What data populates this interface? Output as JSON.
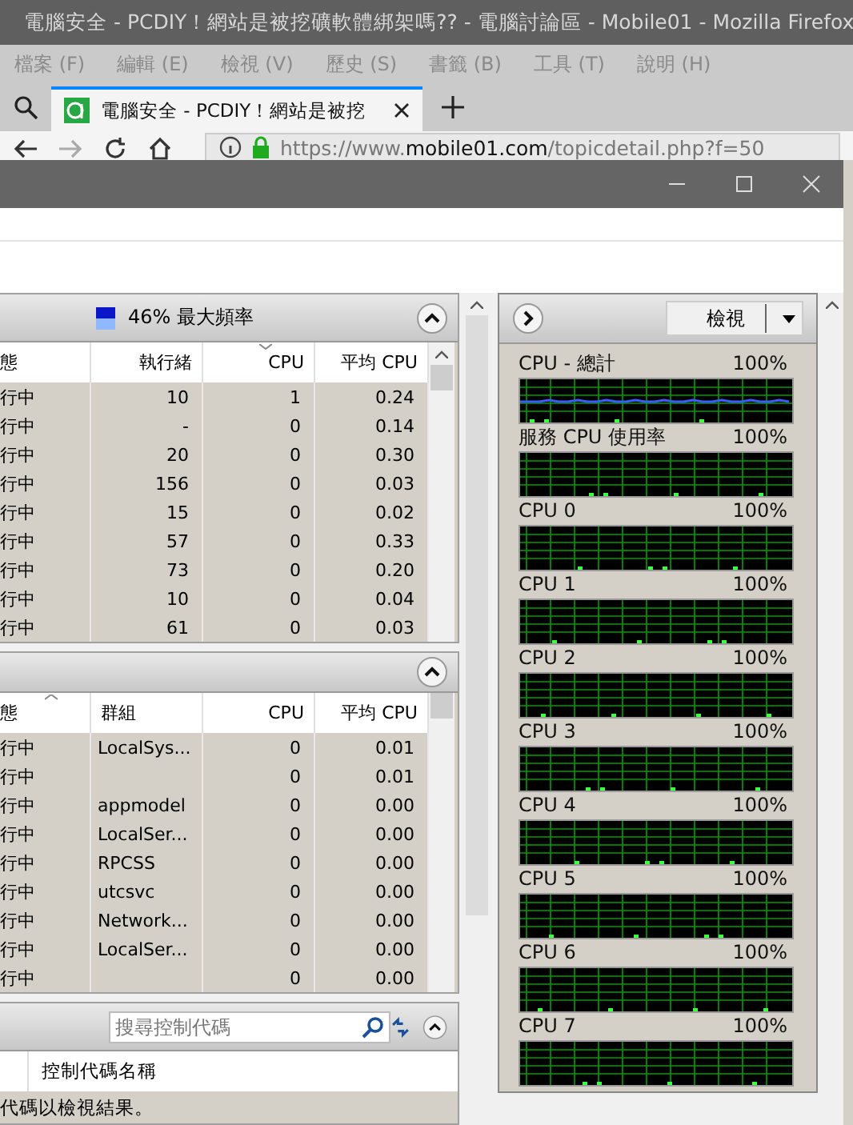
{
  "browser": {
    "title": "電腦安全 - PCDIY！網站是被挖礦軟體綁架嗎?? - 電腦討論區 - Mobile01 - Mozilla Firefox",
    "menu": [
      "檔案 (F)",
      "編輯 (E)",
      "檢視 (V)",
      "歷史 (S)",
      "書籤 (B)",
      "工具 (T)",
      "說明 (H)"
    ],
    "tab": {
      "title": "電腦安全 - PCDIY！網站是被挖",
      "selected": true
    },
    "url": {
      "prefix": "https://www.",
      "domain": "mobile01.com",
      "path": "/topicdetail.php?f=50"
    }
  },
  "cpu_section": {
    "summary": "46% 最大頻率",
    "sort_ascending": false,
    "columns": [
      {
        "label": "態",
        "kind": "text",
        "sorted": false
      },
      {
        "label": "執行緒",
        "kind": "number",
        "sorted": false
      },
      {
        "label": "CPU",
        "kind": "number",
        "sorted": true
      },
      {
        "label": "平均 CPU",
        "kind": "number",
        "sorted": false
      }
    ],
    "rows": [
      [
        "行中",
        "10",
        "1",
        "0.24"
      ],
      [
        "行中",
        "-",
        "0",
        "0.14"
      ],
      [
        "行中",
        "20",
        "0",
        "0.30"
      ],
      [
        "行中",
        "156",
        "0",
        "0.03"
      ],
      [
        "行中",
        "15",
        "0",
        "0.02"
      ],
      [
        "行中",
        "57",
        "0",
        "0.33"
      ],
      [
        "行中",
        "73",
        "0",
        "0.20"
      ],
      [
        "行中",
        "10",
        "0",
        "0.04"
      ],
      [
        "行中",
        "61",
        "0",
        "0.03"
      ]
    ]
  },
  "services_section": {
    "sort_ascending": true,
    "columns": [
      {
        "label": "態",
        "kind": "text",
        "sorted": true
      },
      {
        "label": "群組",
        "kind": "text",
        "sorted": false
      },
      {
        "label": "CPU",
        "kind": "number",
        "sorted": false
      },
      {
        "label": "平均 CPU",
        "kind": "number",
        "sorted": false
      }
    ],
    "rows": [
      [
        "行中",
        "LocalSys...",
        "0",
        "0.01"
      ],
      [
        "行中",
        null,
        "0",
        "0.01"
      ],
      [
        "行中",
        "appmodel",
        "0",
        "0.00"
      ],
      [
        "行中",
        "LocalSer...",
        "0",
        "0.00"
      ],
      [
        "行中",
        "RPCSS",
        "0",
        "0.00"
      ],
      [
        "行中",
        "utcsvc",
        "0",
        "0.00"
      ],
      [
        "行中",
        "Network...",
        "0",
        "0.00"
      ],
      [
        "行中",
        "LocalSer...",
        "0",
        "0.00"
      ],
      [
        "行中",
        null,
        "0",
        "0.00"
      ]
    ]
  },
  "handles_section": {
    "search": {
      "placeholder": "搜尋控制代碼"
    },
    "column": "控制代碼名稱",
    "message": "代碼以檢視結果。"
  },
  "graphs_panel": {
    "view_button": "檢視",
    "graphs": [
      {
        "label": "CPU - 總計",
        "max": "100%",
        "kind": "total"
      },
      {
        "label": "服務 CPU 使用率",
        "max": "100%",
        "kind": "core"
      },
      {
        "label": "CPU 0",
        "max": "100%",
        "kind": "core"
      },
      {
        "label": "CPU 1",
        "max": "100%",
        "kind": "core"
      },
      {
        "label": "CPU 2",
        "max": "100%",
        "kind": "core"
      },
      {
        "label": "CPU 3",
        "max": "100%",
        "kind": "core"
      },
      {
        "label": "CPU 4",
        "max": "100%",
        "kind": "core"
      },
      {
        "label": "CPU 5",
        "max": "100%",
        "kind": "core"
      },
      {
        "label": "CPU 6",
        "max": "100%",
        "kind": "core"
      },
      {
        "label": "CPU 7",
        "max": "100%",
        "kind": "core"
      }
    ]
  }
}
